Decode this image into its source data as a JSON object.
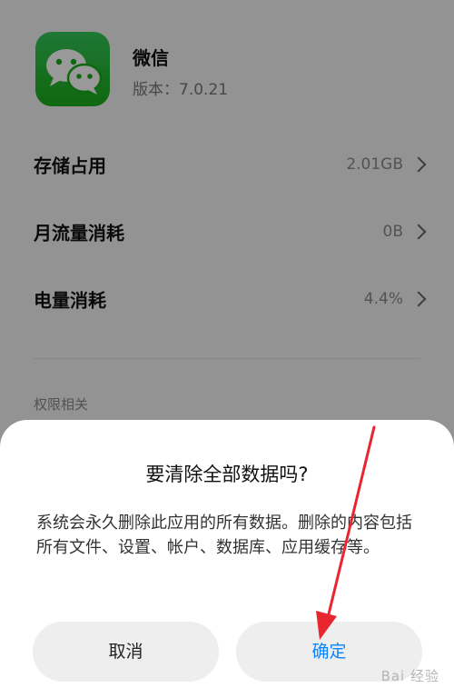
{
  "app": {
    "name": "微信",
    "version": "版本：7.0.21"
  },
  "rows": [
    {
      "label": "存储占用",
      "value": "2.01GB"
    },
    {
      "label": "月流量消耗",
      "value": "0B"
    },
    {
      "label": "电量消耗",
      "value": "4.4%"
    }
  ],
  "section_title": "权限相关",
  "dialog": {
    "title": "要清除全部数据吗?",
    "message": "系统会永久删除此应用的所有数据。删除的内容包括所有文件、设置、帐户、数据库、应用缓存等。",
    "cancel_label": "取消",
    "confirm_label": "确定"
  },
  "colors": {
    "accent": "#0a84ff",
    "app_icon": "#1aad19",
    "arrow": "#e8262e"
  },
  "icons": {
    "app": "wechat-app-icon",
    "chevron": "chevron-right-icon"
  },
  "watermark": "Bai 经验"
}
